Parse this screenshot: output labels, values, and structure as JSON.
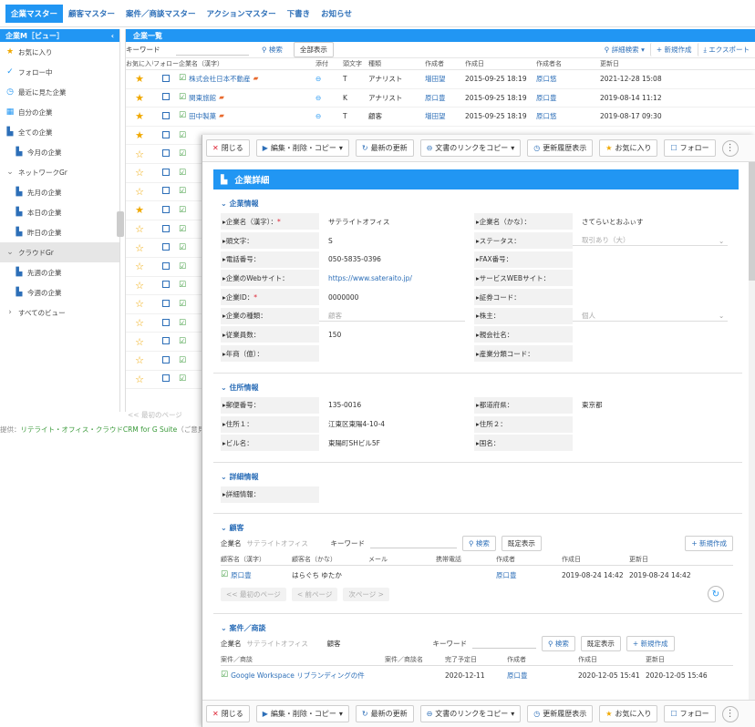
{
  "topnav": [
    "企業マスター",
    "顧客マスター",
    "案件／商談マスター",
    "アクションマスター",
    "下書き",
    "お知らせ"
  ],
  "left": {
    "header": "企業M［ビュー］",
    "items": [
      {
        "icon": "star-icon",
        "label": "お気に入り",
        "glyph": "★",
        "color": "#f0a800"
      },
      {
        "icon": "check-icon",
        "label": "フォロー中",
        "glyph": "✓",
        "color": "#2196f3"
      },
      {
        "icon": "clock-icon",
        "label": "最近に見た企業",
        "glyph": "◷",
        "color": "#2196f3"
      },
      {
        "icon": "grid-icon",
        "label": "自分の企業",
        "glyph": "▦",
        "color": "#2196f3"
      },
      {
        "icon": "building-icon",
        "label": "全ての企業",
        "glyph": "▙",
        "color": "#2d6fb8"
      },
      {
        "icon": "building-icon",
        "label": "今月の企業",
        "glyph": "▙",
        "color": "#2d6fb8"
      },
      {
        "icon": "chevron-down-icon",
        "label": "ネットワークGr",
        "glyph": "⌄",
        "color": "#777"
      },
      {
        "icon": "building-icon",
        "label": "先月の企業",
        "glyph": "▙",
        "color": "#2d6fb8"
      },
      {
        "icon": "building-icon",
        "label": "本日の企業",
        "glyph": "▙",
        "color": "#2d6fb8"
      },
      {
        "icon": "building-icon",
        "label": "昨日の企業",
        "glyph": "▙",
        "color": "#2d6fb8"
      },
      {
        "icon": "chevron-down-icon",
        "label": "クラウドGr",
        "glyph": "⌄",
        "color": "#777"
      },
      {
        "icon": "building-icon",
        "label": "先週の企業",
        "glyph": "▙",
        "color": "#2d6fb8"
      },
      {
        "icon": "building-icon",
        "label": "今週の企業",
        "glyph": "▙",
        "color": "#2d6fb8"
      },
      {
        "icon": "chevron-right-icon",
        "label": "すべてのビュー",
        "glyph": "›",
        "color": "#777"
      }
    ]
  },
  "main": {
    "header": "企業一覧",
    "keyword_label": "キーワード",
    "search_btn": "検索",
    "show_all_btn": "全部表示",
    "detail_search": "詳細検索",
    "new_btn": "新規作成",
    "export_btn": "エクスポート",
    "columns": [
      "お気に入り",
      "フォロー",
      "企業名（漢字）",
      "添付",
      "頭文字",
      "種類",
      "作成者",
      "作成日",
      "作成者名",
      "更新日"
    ],
    "rows": [
      {
        "star": "★",
        "name": "株式会社日本不動産",
        "head": "T",
        "type": "アナリスト",
        "creator": "増田望",
        "created": "2015-09-25 18:19",
        "cname": "原口悠",
        "updated": "2021-12-28 15:08"
      },
      {
        "star": "★",
        "name": "関東旅館",
        "head": "K",
        "type": "アナリスト",
        "creator": "原口豊",
        "created": "2015-09-25 18:19",
        "cname": "原口豊",
        "updated": "2019-08-14 11:12"
      },
      {
        "star": "★",
        "name": "田中製菓",
        "head": "T",
        "type": "顧客",
        "creator": "増田望",
        "created": "2015-09-25 18:19",
        "cname": "原口悠",
        "updated": "2019-08-17 09:30"
      }
    ],
    "more_stars": [
      "★",
      "☆",
      "☆",
      "☆",
      "★",
      "☆",
      "☆",
      "☆",
      "☆",
      "☆",
      "☆",
      "☆",
      "☆",
      "☆"
    ],
    "pager_text": "<< 最初のページ"
  },
  "footer": {
    "prefix": "提供：",
    "link": "リテライト・オフィス・クラウドCRM for G Suite",
    "suffix": "（ご意見"
  },
  "modal": {
    "toolbar": {
      "close": "閉じる",
      "edit": "編集・削除・コピー",
      "refresh": "最新の更新",
      "copy_link": "文書のリンクをコピー",
      "history": "更新履歴表示",
      "favorite": "お気に入り",
      "follow": "フォロー"
    },
    "title": "企業詳細",
    "sections": {
      "company": "企業情報",
      "address": "住所情報",
      "detail": "詳細情報",
      "customers": "顧客",
      "deals": "案件／商談"
    },
    "company_fields": [
      {
        "l": "企業名（漢字）：",
        "req": "*",
        "v": "サテライトオフィス",
        "l2": "企業名（かな）：",
        "v2": "さてらいとおふぃす"
      },
      {
        "l": "頭文字：",
        "v": "S",
        "l2": "ステータス：",
        "v2": "取引あり（大）",
        "sel2": true
      },
      {
        "l": "電話番号：",
        "v": "050-5835-0396",
        "l2": "FAX番号：",
        "v2": ""
      },
      {
        "l": "企業のWebサイト：",
        "v": "https://www.sateraito.jp/",
        "link": true,
        "l2": "サービスWEBサイト：",
        "v2": ""
      },
      {
        "l": "企業ID：",
        "req": "*",
        "v": "0000000",
        "l2": "証券コード：",
        "v2": ""
      },
      {
        "l": "企業の種類：",
        "v": "顧客",
        "sel": true,
        "l2": "株主：",
        "v2": "個人",
        "sel2": true
      },
      {
        "l": "従業員数：",
        "v": "150",
        "l2": "親会社名：",
        "v2": ""
      },
      {
        "l": "年商（億）：",
        "v": "",
        "l2": "産業分類コード：",
        "v2": ""
      }
    ],
    "address_fields": [
      {
        "l": "郵便番号：",
        "v": "135-0016",
        "l2": "都道府県：",
        "v2": "東京都"
      },
      {
        "l": "住所１：",
        "v": "江東区東陽4-10-4",
        "l2": "住所２：",
        "v2": ""
      },
      {
        "l": "ビル名：",
        "v": "東陽町SHビル5F",
        "l2": "国名：",
        "v2": ""
      }
    ],
    "detail_fields": [
      {
        "l": "詳細情報：",
        "v": ""
      }
    ],
    "customers": {
      "company_label": "企業名",
      "company_value": "サテライトオフィス",
      "keyword_label": "キーワード",
      "search_btn": "検索",
      "show_btn": "既定表示",
      "new_btn": "新規作成",
      "columns": [
        "顧客名（漢字）",
        "顧客名（かな）",
        "メール",
        "携帯電話",
        "作成者",
        "作成日",
        "更新日"
      ],
      "rows": [
        {
          "name": "原口豊",
          "kana": "はらぐち ゆたか",
          "mail": "",
          "phone": "",
          "creator": "原口豊",
          "created": "2019-08-24 14:42",
          "updated": "2019-08-24 14:42"
        }
      ],
      "pager": {
        "first": "<< 最初のページ",
        "prev": "< 前ページ",
        "next": "次ページ >"
      }
    },
    "deals": {
      "company_label": "企業名",
      "company_value": "サテライトオフィス",
      "customer_label": "顧客",
      "keyword_label": "キーワード",
      "search_btn": "検索",
      "show_btn": "既定表示",
      "new_btn": "新規作成",
      "columns": [
        "案件／商談",
        "案件／商談名",
        "完了予定日",
        "作成者",
        "作成日",
        "更新日"
      ],
      "rows": [
        {
          "name": "Google Workspace リブランディングの件",
          "due": "2020-12-11",
          "creator": "原口豊",
          "created": "2020-12-05 15:41",
          "updated": "2020-12-05 15:46"
        }
      ]
    }
  }
}
